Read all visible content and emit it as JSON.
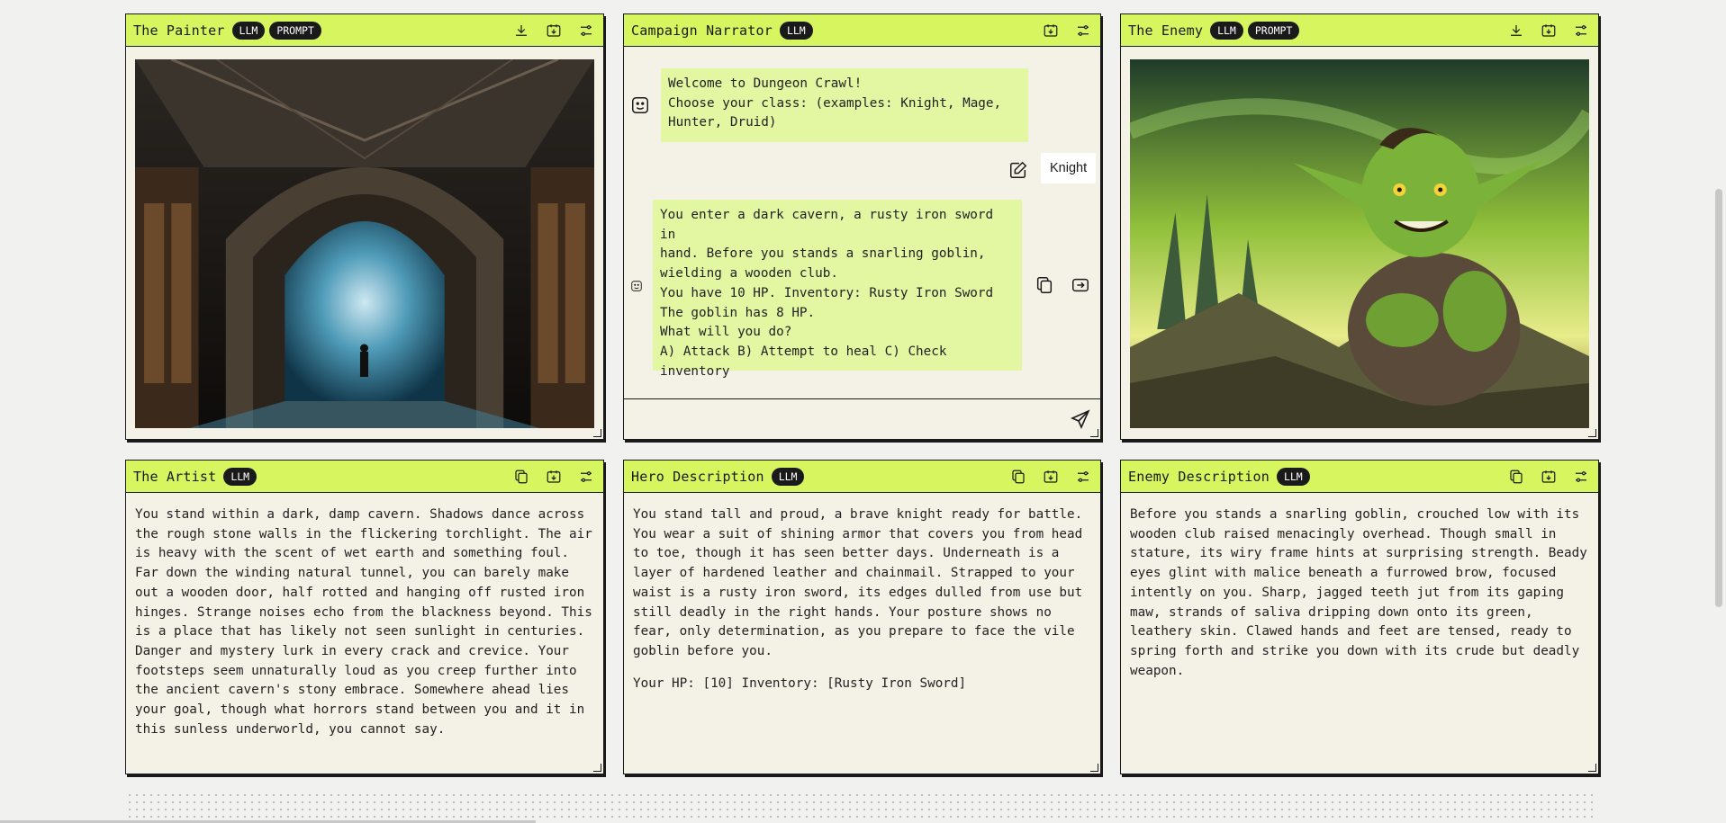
{
  "panels": {
    "painter": {
      "title": "The Painter",
      "badges": [
        "LLM",
        "PROMPT"
      ]
    },
    "narrator": {
      "title": "Campaign Narrator",
      "badges": [
        "LLM"
      ]
    },
    "enemy": {
      "title": "The Enemy",
      "badges": [
        "LLM",
        "PROMPT"
      ]
    },
    "artist": {
      "title": "The Artist",
      "badges": [
        "LLM"
      ],
      "text": "You stand within a dark, damp cavern. Shadows dance across the rough stone walls in the flickering torchlight. The air is heavy with the scent of wet earth and something foul. Far down the winding natural tunnel, you can barely make out a wooden door, half rotted and hanging off rusted iron hinges. Strange noises echo from the blackness beyond. This is a place that has likely not seen sunlight in centuries. Danger and mystery lurk in every crack and crevice. Your footsteps seem unnaturally loud as you creep further into the ancient cavern's stony embrace. Somewhere ahead lies your goal, though what horrors stand between you and it in this sunless underworld, you cannot say."
    },
    "hero": {
      "title": "Hero Description",
      "badges": [
        "LLM"
      ],
      "text": "You stand tall and proud, a brave knight ready for battle. You wear a suit of shining armor that covers you from head to toe, though it has seen better days. Underneath is a layer of hardened leather and chainmail. Strapped to your waist is a rusty iron sword, its edges dulled from use but still deadly in the right hands. Your posture shows no fear, only determination, as you prepare to face the vile goblin before you.",
      "stats": "Your HP: [10] Inventory: [Rusty Iron Sword]"
    },
    "enemy_desc": {
      "title": "Enemy Description",
      "badges": [
        "LLM"
      ],
      "text": "Before you stands a snarling goblin, crouched low with its wooden club raised menacingly overhead. Though small in stature, its wiry frame hints at surprising strength. Beady eyes glint with malice beneath a furrowed brow, focused intently on you. Sharp, jagged teeth jut from its gaping maw, strands of saliva dripping down onto its green, leathery skin. Clawed hands and feet are tensed, ready to spring forth and strike you down with its crude but deadly weapon."
    }
  },
  "chat": {
    "messages": [
      {
        "role": "bot",
        "text": "Welcome to Dungeon Crawl!\nChoose your class: (examples: Knight, Mage,\nHunter, Druid)"
      },
      {
        "role": "user",
        "text": "Knight"
      },
      {
        "role": "bot",
        "text": "You enter a dark cavern, a rusty iron sword in\nhand. Before you stands a snarling goblin,\nwielding a wooden club.\nYou have 10 HP. Inventory: Rusty Iron Sword\nThe goblin has 8 HP.\nWhat will you do?\nA) Attack B) Attempt to heal C) Check\ninventory"
      }
    ],
    "input_value": ""
  },
  "colors": {
    "header": "#d6f55f",
    "bot_bubble": "#e3f7a3",
    "panel_bg": "#f4f1e6"
  }
}
